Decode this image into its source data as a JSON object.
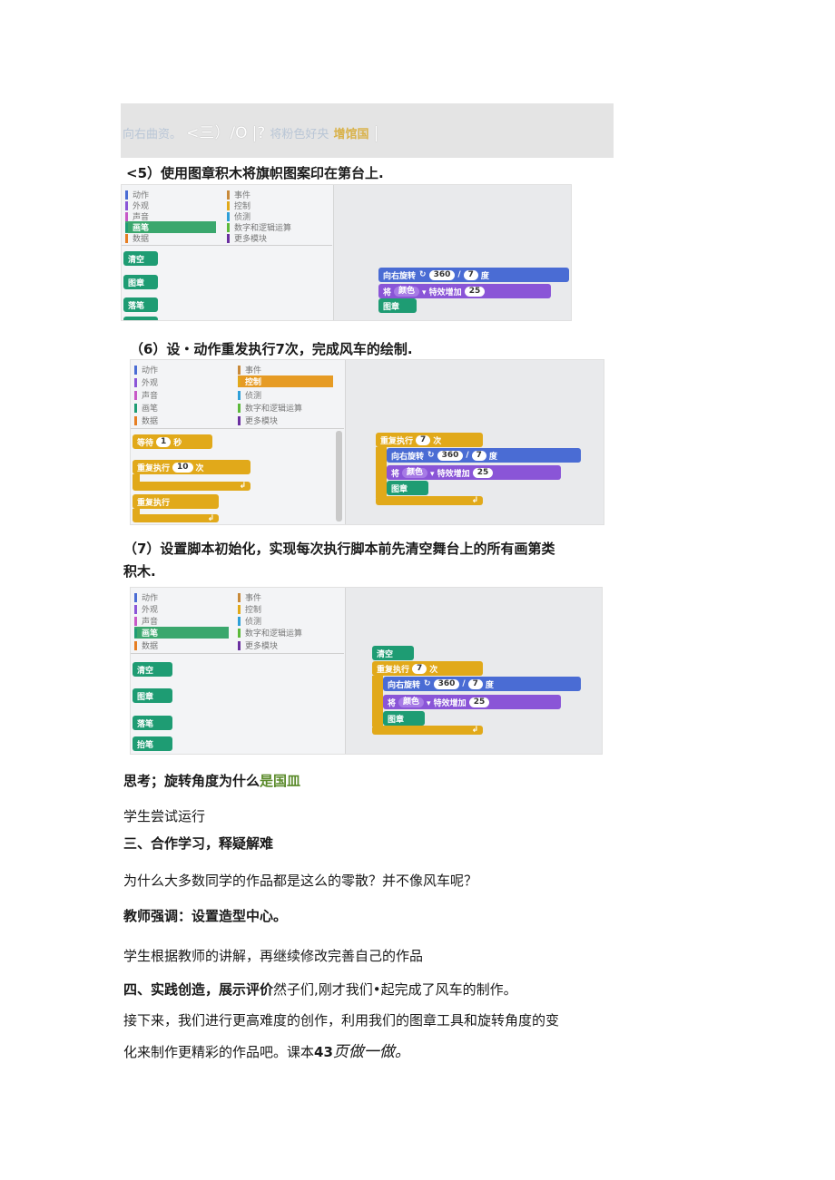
{
  "banner": {
    "part1": "向右曲资。",
    "part2": "<三）/O",
    "part3": "|?",
    "part4": "将粉色好央",
    "part5": "增馆国",
    "part6": "|"
  },
  "step5": {
    "label": "<5）使用图章积木将旗帜图案印在第台上."
  },
  "step6": {
    "label": "（6）设・动作重发执行7次，完成风车的绘制."
  },
  "step7": {
    "line1": "（7）设置脚本初始化，实现每次执行脚本前先清空舞台上的所有画第类",
    "line2": "积木."
  },
  "categories": {
    "left": [
      "动作",
      "外观",
      "声音",
      "画笔",
      "数据"
    ],
    "right": [
      "事件",
      "控制",
      "侦测",
      "数字和逻辑运算",
      "更多模块"
    ],
    "colors_left": [
      "#4a6cd4",
      "#8a55d7",
      "#c759c7",
      "#1e9c73",
      "#e67e22"
    ],
    "colors_right": [
      "#c88a3a",
      "#e1a91a",
      "#2e9fd8",
      "#5cb93a",
      "#6a2fa0"
    ]
  },
  "blocks": {
    "clear": "清空",
    "stamp": "图章",
    "pen_down": "落笔",
    "pen_up": "抬笔",
    "turn_right": "向右旋转",
    "turn_icon": "↻",
    "angle_a": "360",
    "slash": "/",
    "angle_b": "7",
    "degree": "度",
    "change_effect": "将",
    "effect_name": "颜色",
    "effect_rest": "▾ 特效增加",
    "effect_amount": "25",
    "wait": "等待",
    "wait_val": "1",
    "wait_unit": "秒",
    "repeat": "重复执行",
    "repeat_val10": "10",
    "repeat_val7": "7",
    "times": "次",
    "forever": "重复执行",
    "end_arrow": "↲"
  },
  "think": {
    "prefix": "思考；旋转角度为什么",
    "highlight": "是国皿"
  },
  "p_try": "学生尝试运行",
  "h3": "三、合作学习，释疑解难",
  "p_why": "为什么大多数同学的作品都是这么的零散？并不像风车呢？",
  "p_teacher": "教师强调：设置造型中心。",
  "p_modify": "学生根据教师的讲解，再继续修改完善自己的作品",
  "h4": {
    "bold": "四、实践创造，展示评价",
    "rest": "然子们,刚才我们•起完成了风车的制作。"
  },
  "p_next1": "接下来，我们进行更高难度的创作，利用我们的图章工具和旋转角度的变",
  "p_next2": {
    "plain": "化来制作更精彩的作品吧。课本",
    "num": "43",
    "italic": "页做一做。"
  }
}
